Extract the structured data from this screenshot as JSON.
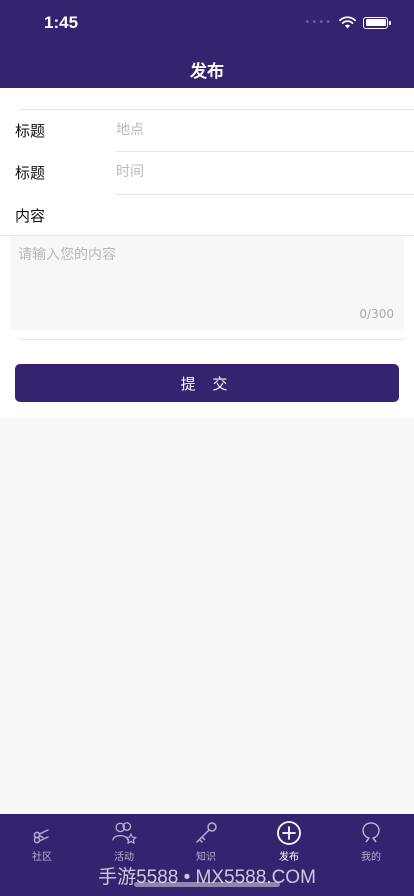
{
  "status_bar": {
    "time": "1:45"
  },
  "nav": {
    "title": "发布"
  },
  "form": {
    "place_label": "标题",
    "place_placeholder": "地点",
    "time_label": "标题",
    "time_placeholder": "时间",
    "content_label": "内容",
    "content_placeholder": "请输入您的内容",
    "counter": "0/300",
    "submit_label": "提 交"
  },
  "tabbar": {
    "items": [
      {
        "label": "社区",
        "icon": "scissors-icon"
      },
      {
        "label": "活动",
        "icon": "users-star-icon"
      },
      {
        "label": "知识",
        "icon": "key-icon"
      },
      {
        "label": "发布",
        "icon": "plus-circle-icon"
      },
      {
        "label": "我的",
        "icon": "person-icon"
      }
    ]
  },
  "watermark": "手游5588 • MX5588.COM",
  "colors": {
    "brand": "#35236f",
    "background": "#f7f7f7"
  }
}
